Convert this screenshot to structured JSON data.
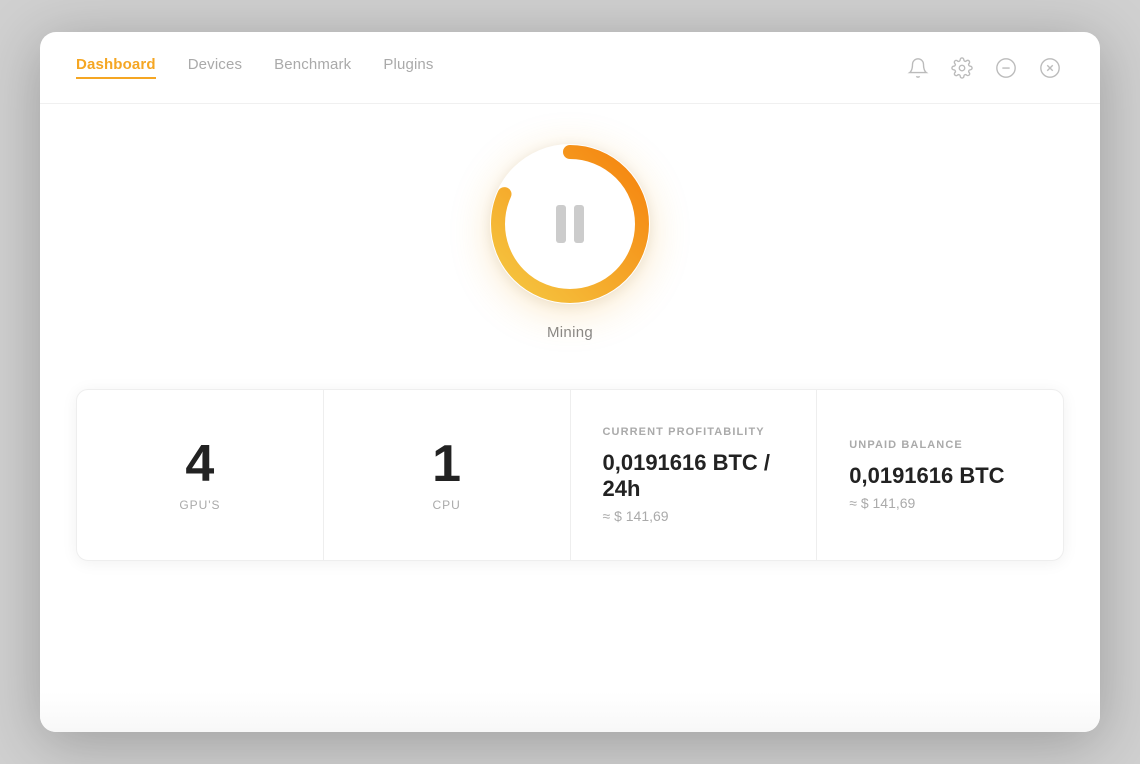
{
  "nav": {
    "tabs": [
      {
        "label": "Dashboard",
        "active": true
      },
      {
        "label": "Devices",
        "active": false
      },
      {
        "label": "Benchmark",
        "active": false
      },
      {
        "label": "Plugins",
        "active": false
      }
    ]
  },
  "mining": {
    "state": "paused",
    "label": "Mining"
  },
  "stats": {
    "gpus": {
      "value": "4",
      "label": "GPU'S"
    },
    "cpu": {
      "value": "1",
      "label": "CPU"
    },
    "profitability": {
      "title": "CURRENT PROFITABILITY",
      "btc": "0,0191616 BTC / 24h",
      "usd": "≈ $ 141,69"
    },
    "unpaid": {
      "title": "UNPAID BALANCE",
      "btc": "0,0191616 BTC",
      "usd": "≈ $ 141,69"
    }
  }
}
